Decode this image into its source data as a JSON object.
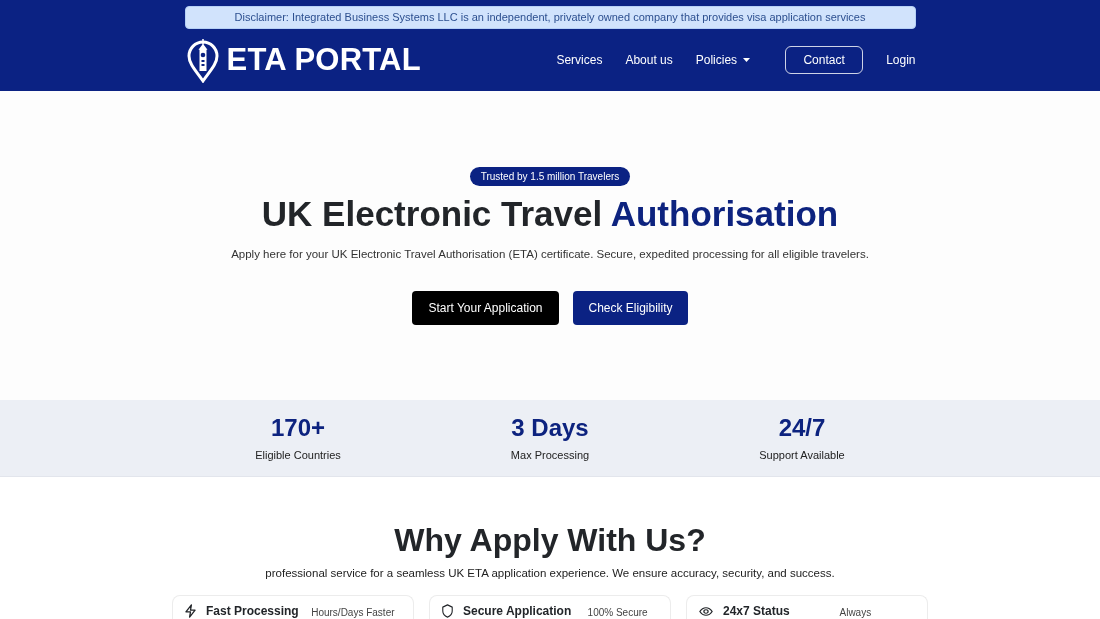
{
  "disclaimer": "Disclaimer: Integrated Business Systems LLC is an independent, privately owned company that provides visa application services",
  "header": {
    "logo_text": "ETA PORTAL",
    "nav": [
      {
        "label": "Services",
        "kind": "link"
      },
      {
        "label": "About us",
        "kind": "link"
      },
      {
        "label": "Policies",
        "kind": "dropdown"
      },
      {
        "label": "Contact",
        "kind": "outlined"
      },
      {
        "label": "Login",
        "kind": "link"
      }
    ]
  },
  "hero": {
    "badge": "Trusted by 1.5 million Travelers",
    "title": "UK Electronic Travel",
    "title_highlight": "Authorisation",
    "subtitle": "Apply here for your UK Electronic Travel Authorisation (ETA) certificate. Secure, expedited processing for all eligible travelers.",
    "buttons": [
      {
        "label": "Start Your Application",
        "kind": "dark"
      },
      {
        "label": "Check Eligibility",
        "kind": "blue"
      }
    ]
  },
  "stats": [
    {
      "value": "170+",
      "label": "Eligible Countries"
    },
    {
      "value": "3 Days",
      "label": "Max Processing"
    },
    {
      "value": "24/7",
      "label": "Support Available"
    }
  ],
  "why": {
    "title": "Why Apply With Us?",
    "subtitle": "professional service for a seamless UK ETA application experience. We ensure accuracy, security, and success.",
    "features": [
      {
        "title": "Fast Processing",
        "tag": "Hours/Days Faster"
      },
      {
        "title": "Secure Application",
        "tag": "100% Secure"
      },
      {
        "title": "24x7 Status",
        "tag": "Always"
      }
    ]
  }
}
